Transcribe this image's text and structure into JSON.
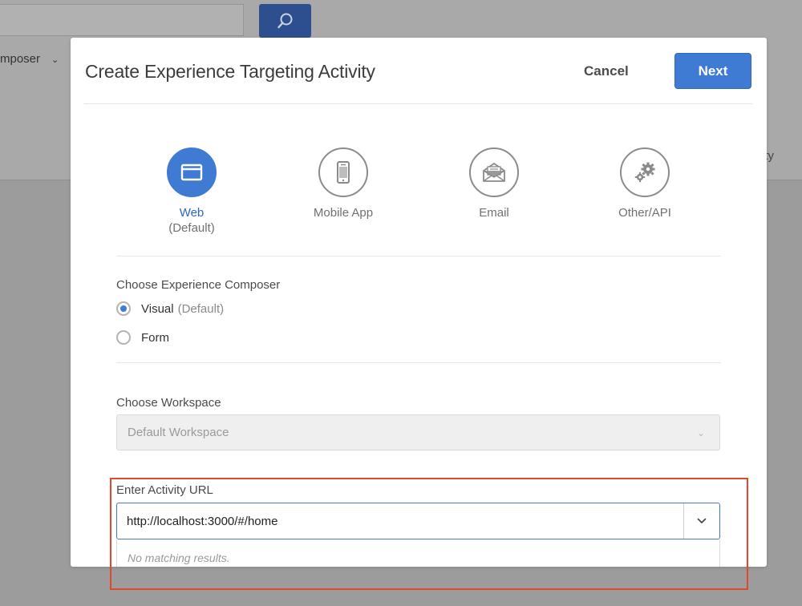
{
  "background": {
    "composer_label": "mposer",
    "right_fragment": "ity"
  },
  "dialog": {
    "title": "Create Experience Targeting Activity",
    "cancel_label": "Cancel",
    "next_label": "Next"
  },
  "channels": [
    {
      "label": "Web",
      "sub": "(Default)",
      "icon": "browser-window-icon",
      "selected": true
    },
    {
      "label": "Mobile App",
      "sub": "",
      "icon": "mobile-phone-icon",
      "selected": false
    },
    {
      "label": "Email",
      "sub": "",
      "icon": "envelope-icon",
      "selected": false
    },
    {
      "label": "Other/API",
      "sub": "",
      "icon": "gears-icon",
      "selected": false
    }
  ],
  "composer": {
    "label": "Choose Experience Composer",
    "options": [
      {
        "label": "Visual",
        "hint": "(Default)",
        "checked": true
      },
      {
        "label": "Form",
        "hint": "",
        "checked": false
      }
    ]
  },
  "workspace": {
    "label": "Choose Workspace",
    "value": "Default Workspace"
  },
  "activity_url": {
    "label": "Enter Activity URL",
    "value": "http://localhost:3000/#/home",
    "no_results": "No matching results."
  },
  "colors": {
    "accent": "#3f7bd3",
    "highlight": "#e0492d"
  }
}
